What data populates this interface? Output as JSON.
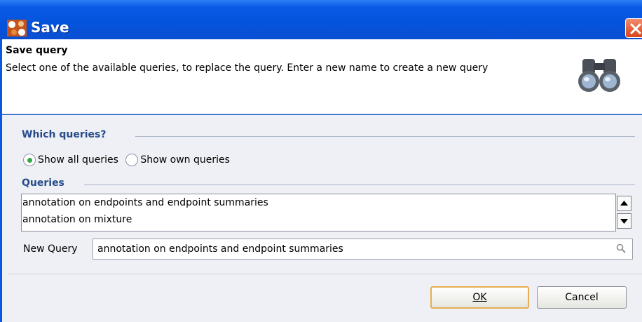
{
  "window": {
    "title": "Save"
  },
  "header": {
    "title": "Save query",
    "description": "Select one of the available queries, to replace the query. Enter a new name to create a new query"
  },
  "which_queries": {
    "heading": "Which queries?",
    "options": [
      {
        "label": "Show all queries",
        "selected": true
      },
      {
        "label": "Show own queries",
        "selected": false
      }
    ]
  },
  "queries": {
    "heading": "Queries",
    "items": [
      "annotation on endpoints and endpoint summaries",
      "annotation on mixture"
    ]
  },
  "new_query": {
    "label": "New Query",
    "value": "annotation on endpoints and endpoint summaries"
  },
  "buttons": {
    "ok": "OK",
    "cancel": "Cancel"
  },
  "colors": {
    "titlebar": "#0553dc",
    "section_heading": "#274b8a",
    "default_button_border": "#e7ad53"
  }
}
